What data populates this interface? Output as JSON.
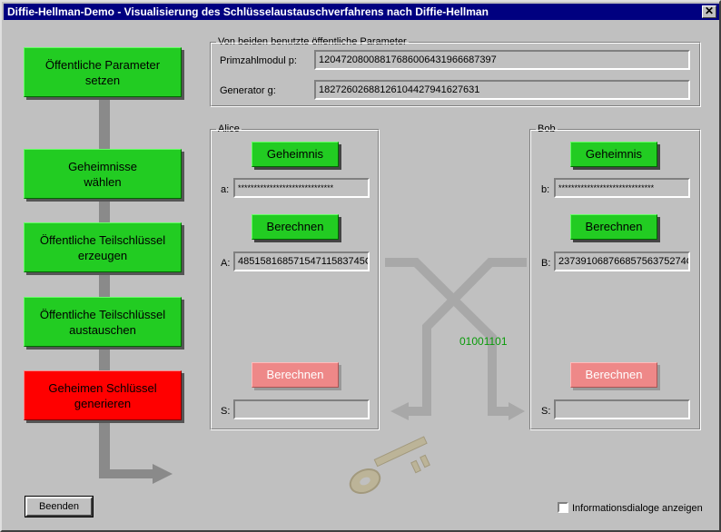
{
  "window": {
    "title": "Diffie-Hellman-Demo - Visualisierung des Schlüsselaustauschverfahrens nach Diffie-Hellman",
    "close": "✕"
  },
  "steps": [
    {
      "label": "Öffentliche Parameter\nsetzen"
    },
    {
      "label": "Geheimnisse\nwählen"
    },
    {
      "label": "Öffentliche Teilschlüssel\nerzeugen"
    },
    {
      "label": "Öffentliche Teilschlüssel\naustauschen"
    },
    {
      "label": "Geheimen Schlüssel\ngenerieren"
    }
  ],
  "params": {
    "title": "Von beiden benutzte öffentliche Parameter",
    "p_label": "Primzahlmodul p:",
    "p_value": "12047208008817686006431966687397",
    "g_label": "Generator g:",
    "g_value": "18272602688126104427941627631"
  },
  "alice": {
    "title": "Alice",
    "secret_button": "Geheimnis",
    "a_label": "a:",
    "a_value": "******************************",
    "compute_button": "Berechnen",
    "A_label": "A:",
    "A_value": "48515816857154711583745O",
    "final_button": "Berechnen",
    "S_label": "S:",
    "S_value": ""
  },
  "bob": {
    "title": "Bob",
    "secret_button": "Geheimnis",
    "b_label": "b:",
    "b_value": "******************************",
    "compute_button": "Berechnen",
    "B_label": "B:",
    "B_value": "23739106876685756375274O",
    "final_button": "Berechnen",
    "S_label": "S:",
    "S_value": ""
  },
  "exchange_bits": "01001101",
  "footer": {
    "quit_button": "Beenden",
    "info_checkbox_label": "Informationsdialoge anzeigen",
    "info_checkbox_checked": false
  },
  "colors": {
    "step_green": "#22cc22",
    "step_red": "#ff0000",
    "titlebar": "#000080",
    "bits": "#0a9a0a"
  },
  "icons": {
    "key": "key-icon",
    "arrows": "exchange-arrows"
  }
}
